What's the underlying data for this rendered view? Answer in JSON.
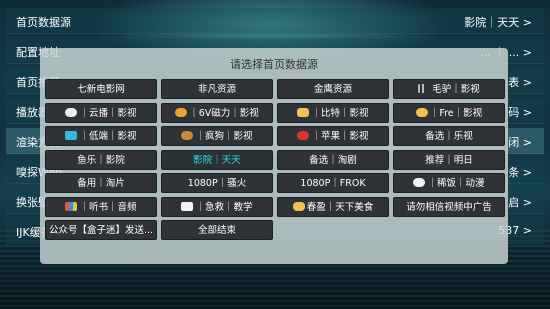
{
  "settings": {
    "rows": [
      {
        "label": "首页数据源",
        "value": "影院｜天天 >"
      },
      {
        "label": "配置地址",
        "value": "... ｜ ... >"
      },
      {
        "label": "首页推荐",
        "value": "表 >"
      },
      {
        "label": "播放器",
        "value": "码 >"
      },
      {
        "label": "渲染方式",
        "value": "闭 >"
      },
      {
        "label": "嗅探Web",
        "value": "条 >"
      },
      {
        "label": "换张壁纸",
        "value": "启 >"
      },
      {
        "label": "IJK缓存",
        "value": "537 >"
      }
    ]
  },
  "dialog": {
    "title": "请选择首页数据源",
    "options": [
      {
        "label": "七新电影网",
        "icon": "none"
      },
      {
        "label": "非凡资源",
        "icon": "none"
      },
      {
        "label": "金鹰资源",
        "icon": "none"
      },
      {
        "label": "毛驴｜影视",
        "icon": "bars-icon"
      },
      {
        "label": "｜云播｜影视",
        "icon": "cloud-icon"
      },
      {
        "label": "｜6V磁力｜影视",
        "icon": "bird-icon"
      },
      {
        "label": "｜比特｜影视",
        "icon": "victory-hand-icon"
      },
      {
        "label": "｜Fre｜影视",
        "icon": "ok-hand-icon"
      },
      {
        "label": "｜低端｜影视",
        "icon": "tv-icon"
      },
      {
        "label": "｜疯狗｜影视",
        "icon": "dog-icon"
      },
      {
        "label": "｜苹果｜影视",
        "icon": "apple-icon"
      },
      {
        "label": "备选｜乐视",
        "icon": "none"
      },
      {
        "label": "鱼乐｜影院",
        "icon": "none"
      },
      {
        "label": "影院｜天天",
        "icon": "none",
        "selected": true
      },
      {
        "label": "备选｜淘剧",
        "icon": "none"
      },
      {
        "label": "推荐｜明日",
        "icon": "none"
      },
      {
        "label": "备用｜淘片",
        "icon": "none"
      },
      {
        "label": "1080P｜骚火",
        "icon": "none"
      },
      {
        "label": "1080P｜FROK",
        "icon": "none"
      },
      {
        "label": "｜稀饭｜动漫",
        "icon": "ball-icon"
      },
      {
        "label": "｜听书｜音频",
        "icon": "books-icon"
      },
      {
        "label": "｜急救｜教学",
        "icon": "ambulance-icon"
      },
      {
        "label": "春盈｜天下美食",
        "icon": "pointing-hand-icon"
      },
      {
        "label": "请勿相信视频中广告",
        "icon": "none"
      },
      {
        "label": "公众号【盒子迷】发送...",
        "icon": "none"
      },
      {
        "label": "全部结束",
        "icon": "none"
      }
    ]
  },
  "colors": {
    "selected_text": "#2fe0e8",
    "option_bg": "#2f3338"
  }
}
